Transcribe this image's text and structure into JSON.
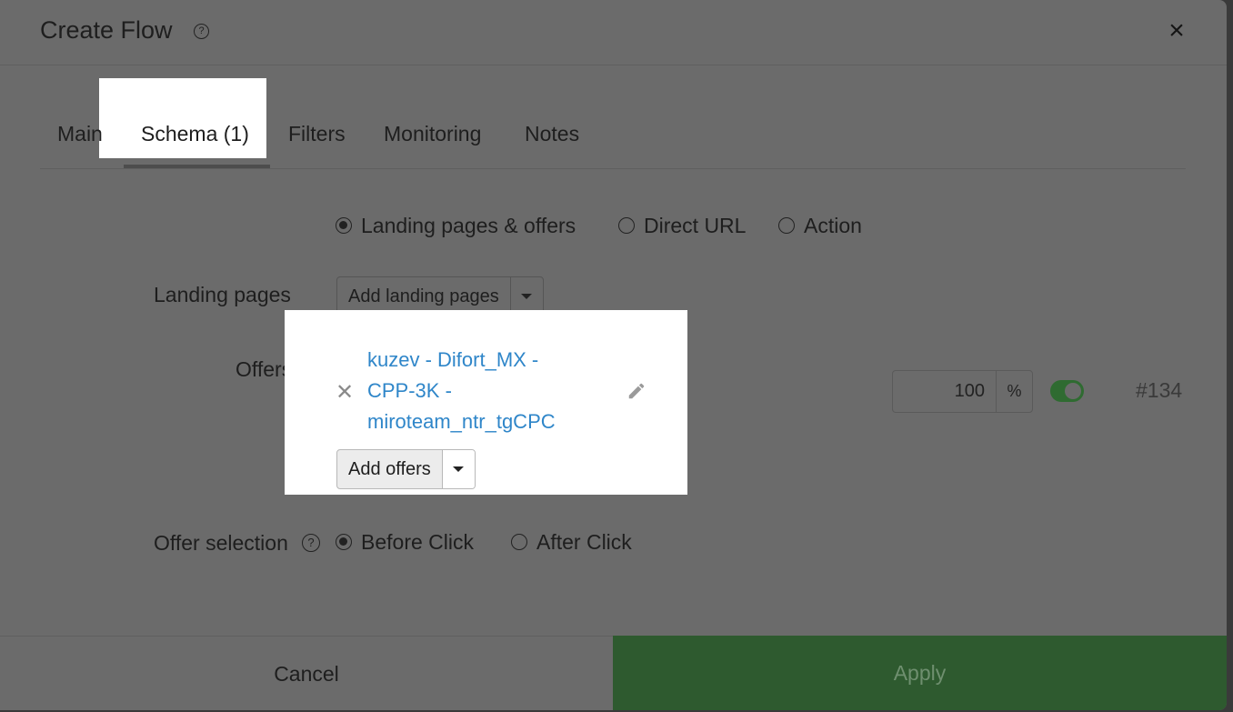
{
  "header": {
    "title": "Create Flow",
    "help_glyph": "?",
    "close_glyph": "×"
  },
  "tabs": [
    {
      "label": "Main"
    },
    {
      "label": "Schema (1)"
    },
    {
      "label": "Filters"
    },
    {
      "label": "Monitoring"
    },
    {
      "label": "Notes"
    }
  ],
  "schema_type": {
    "options": [
      {
        "label": "Landing pages & offers",
        "checked": true
      },
      {
        "label": "Direct URL",
        "checked": false
      },
      {
        "label": "Action",
        "checked": false
      }
    ]
  },
  "landing_pages": {
    "label": "Landing pages",
    "add_button": "Add landing pages"
  },
  "offers": {
    "label": "Offers",
    "remove_glyph": "✕",
    "items": [
      {
        "name_lines": [
          "kuzev - Difort_MX -",
          "CPP-3K -",
          "miroteam_ntr_tgCPC"
        ],
        "weight": "100",
        "unit": "%",
        "enabled": true,
        "id": "#134"
      }
    ],
    "add_button": "Add offers"
  },
  "offer_selection": {
    "label": "Offer selection",
    "help_glyph": "?",
    "options": [
      {
        "label": "Before Click",
        "checked": true
      },
      {
        "label": "After Click",
        "checked": false
      }
    ]
  },
  "footer": {
    "cancel": "Cancel",
    "apply": "Apply"
  },
  "colors": {
    "accent_green": "#2e5a2f",
    "link_blue": "#2f86c9",
    "overlay_gray": "#6b6b6b"
  },
  "icons": {
    "close": "close-icon",
    "help": "help-icon",
    "caret": "caret-down-icon",
    "edit": "pencil-icon",
    "remove": "remove-icon"
  }
}
